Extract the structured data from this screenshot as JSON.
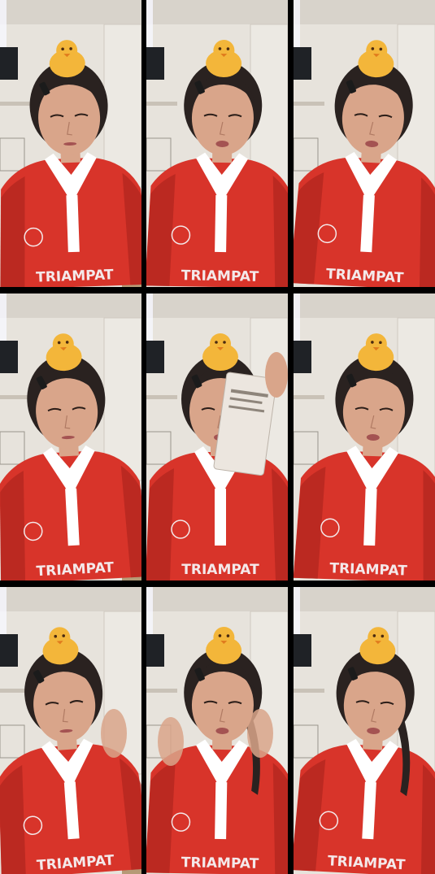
{
  "frames": [
    {
      "id": 1,
      "row": 1,
      "col": 1,
      "jersey_text": "TRIAMPAT",
      "filter": "duck-head"
    },
    {
      "id": 2,
      "row": 1,
      "col": 2,
      "jersey_text": "TRIAMPAT",
      "filter": "duck-head"
    },
    {
      "id": 3,
      "row": 1,
      "col": 3,
      "jersey_text": "TRIAMPAT",
      "filter": "duck-head"
    },
    {
      "id": 4,
      "row": 2,
      "col": 1,
      "jersey_text": "TRIAMPAT",
      "filter": "duck-head"
    },
    {
      "id": 5,
      "row": 2,
      "col": 2,
      "jersey_text": "TRIAMPAT",
      "filter": "duck-head",
      "holding": "product-sachet"
    },
    {
      "id": 6,
      "row": 2,
      "col": 3,
      "jersey_text": "TRIAMPAT",
      "filter": "duck-head"
    },
    {
      "id": 7,
      "row": 3,
      "col": 1,
      "jersey_text": "TRIAMPAT",
      "filter": "duck-head"
    },
    {
      "id": 8,
      "row": 3,
      "col": 2,
      "jersey_text": "TRIAMPAT",
      "filter": "duck-head"
    },
    {
      "id": 9,
      "row": 3,
      "col": 3,
      "jersey_text": "TRIAMPAT",
      "filter": "duck-head"
    }
  ],
  "colors": {
    "background": "#000000",
    "wall": "#e7e3dc",
    "jersey": "#d8342a",
    "collar": "#ffffff",
    "hair": "#2a2220",
    "skin": "#d9a58a",
    "duck": "#f3b63a"
  }
}
